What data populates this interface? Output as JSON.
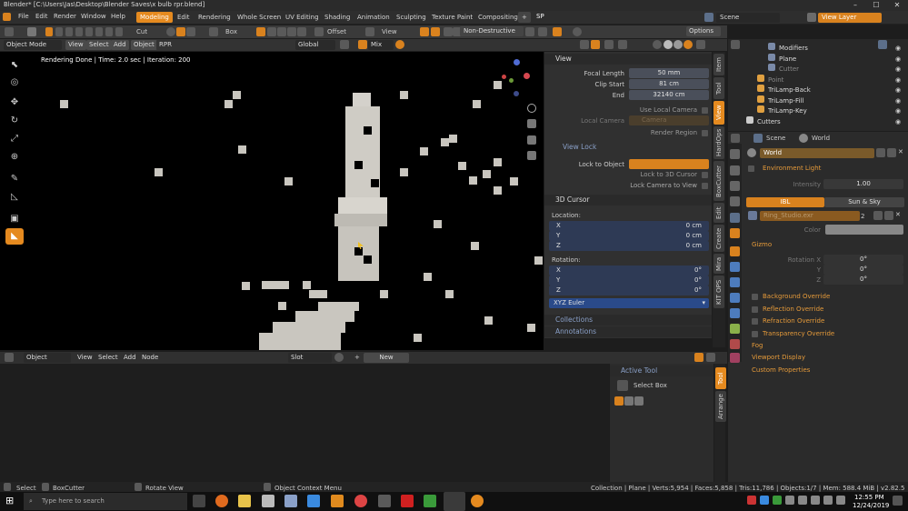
{
  "window": {
    "title": "Blender* [C:\\Users\\Jas\\Desktop\\Blender Saves\\x bulb rpr.blend]",
    "controls": [
      "–",
      "☐",
      "✕"
    ]
  },
  "menu": {
    "items": [
      "File",
      "Edit",
      "Render",
      "Window",
      "Help"
    ],
    "workspaces": [
      "Modeling",
      "Edit",
      "Rendering",
      "Whole Screen",
      "UV Editing",
      "Shading",
      "Animation",
      "Sculpting",
      "Texture Paint",
      "Compositing"
    ],
    "active_workspace": "Modeling",
    "add": "+",
    "sp": "SP",
    "scene": "Scene",
    "view_layer": "View Layer"
  },
  "tool_header": {
    "cut": "Cut",
    "box": "Box",
    "offset": "Offset",
    "view": "View",
    "nondestructive": "Non-Destructive",
    "options": "Options"
  },
  "viewport_header": {
    "mode": "Object Mode",
    "view": "View",
    "select": "Select",
    "add": "Add",
    "object": "Object",
    "rpr": "RPR",
    "orientation": "Global",
    "mix": "Mix"
  },
  "viewport": {
    "render_info": "Rendering Done | Time: 2.0 sec | Iteration: 200"
  },
  "sidebar": {
    "view_section": "View",
    "focal_length_label": "Focal Length",
    "focal_length": "50 mm",
    "clip_start_label": "Clip Start",
    "clip_start": "81 cm",
    "end_label": "End",
    "end": "32140 cm",
    "use_local_camera": "Use Local Camera",
    "local_camera_label": "Local Camera",
    "local_camera": "Camera",
    "render_region": "Render Region",
    "view_lock": "View Lock",
    "lock_to_object": "Lock to Object",
    "lock_to_3d_cursor": "Lock to 3D Cursor",
    "lock_camera_to_view": "Lock Camera to View",
    "cursor_section": "3D Cursor",
    "location_label": "Location:",
    "loc": [
      {
        "axis": "X",
        "value": "0 cm"
      },
      {
        "axis": "Y",
        "value": "0 cm"
      },
      {
        "axis": "Z",
        "value": "0 cm"
      }
    ],
    "rotation_label": "Rotation:",
    "rot": [
      {
        "axis": "X",
        "value": "0°"
      },
      {
        "axis": "Y",
        "value": "0°"
      },
      {
        "axis": "Z",
        "value": "0°"
      }
    ],
    "rotation_mode": "XYZ Euler",
    "collections": "Collections",
    "annotations": "Annotations",
    "tabs": [
      "Item",
      "Tool",
      "View",
      "HardOps",
      "BoxCutter",
      "Edit",
      "Create",
      "Mira",
      "KIT OPS"
    ]
  },
  "node_header": {
    "editor": "Object",
    "view": "View",
    "select": "Select",
    "add": "Add",
    "node": "Node",
    "slot": "Slot",
    "new": "New"
  },
  "active_tool": {
    "title": "Active Tool",
    "tool": "Select Box",
    "tabs": [
      "Tool",
      "Arrange"
    ]
  },
  "outliner": {
    "rows": [
      {
        "name": "Modifiers",
        "indent": 3
      },
      {
        "name": "Plane",
        "indent": 3
      },
      {
        "name": "Cutter",
        "indent": 3
      },
      {
        "name": "Point",
        "indent": 2
      },
      {
        "name": "TriLamp-Back",
        "indent": 2
      },
      {
        "name": "TriLamp-Fill",
        "indent": 2
      },
      {
        "name": "TriLamp-Key",
        "indent": 2
      },
      {
        "name": "Cutters",
        "indent": 1
      }
    ]
  },
  "properties": {
    "tab_scene": "Scene",
    "tab_world": "World",
    "world_name": "World",
    "environment_light": "Environment Light",
    "intensity_label": "Intensity",
    "intensity": "1.00",
    "ibl": "IBL",
    "sun_sky": "Sun & Sky",
    "hdr_file": "Ring_Studio.exr",
    "hdr_users": "2",
    "color_label": "Color",
    "gizmo": "Gizmo",
    "rotation_x_label": "Rotation X",
    "rotation_x": "0°",
    "rot_y_label": "Y",
    "rot_y": "0°",
    "rot_z_label": "Z",
    "rot_z": "0°",
    "overrides": [
      "Background Override",
      "Reflection Override",
      "Refraction Override",
      "Transparency Override"
    ],
    "fog": "Fog",
    "viewport_display": "Viewport Display",
    "custom_properties": "Custom Properties"
  },
  "status": {
    "select": "Select",
    "boxcutter": "BoxCutter",
    "rotate_view": "Rotate View",
    "context_menu": "Object Context Menu",
    "stats": "Collection | Plane | Verts:5,954 | Faces:5,858 | Tris:11,786 | Objects:1/7 | Mem: 588.4 MiB | v2.82.5"
  },
  "taskbar": {
    "search_placeholder": "Type here to search",
    "time": "12:55 PM",
    "date": "12/24/2019"
  },
  "colors": {
    "accent": "#e58a1f",
    "panel": "#303030",
    "field_blue": "#2e3a55"
  }
}
